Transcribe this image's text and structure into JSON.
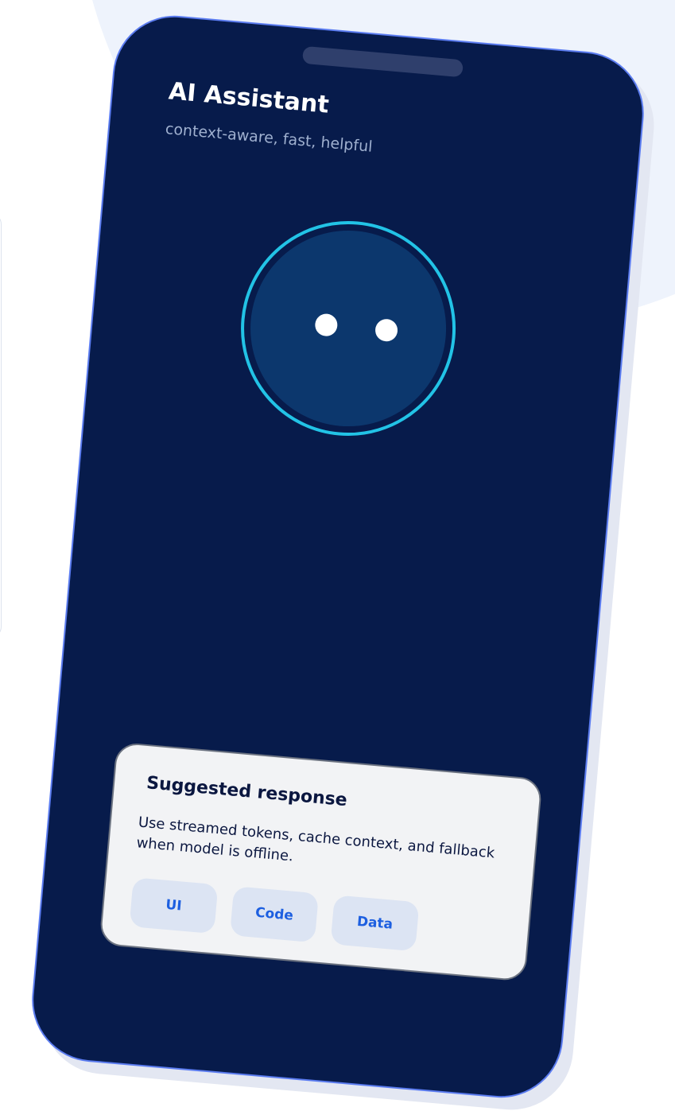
{
  "app": {
    "title": "AI Assistant",
    "subtitle": "context-aware, fast, helpful"
  },
  "avatar": {
    "ring_color": "#22c3e6",
    "face_color": "#0c376d"
  },
  "suggestion_card": {
    "title": "Suggested response",
    "body": "Use streamed tokens, cache context, and fallback when model is offline.",
    "chips": [
      "UI",
      "Code",
      "Data"
    ]
  },
  "colors": {
    "phone_background": "#071b4b",
    "phone_border": "#5b7cf0",
    "chip_text": "#1d5fe0",
    "chip_background": "#dce4f3"
  }
}
